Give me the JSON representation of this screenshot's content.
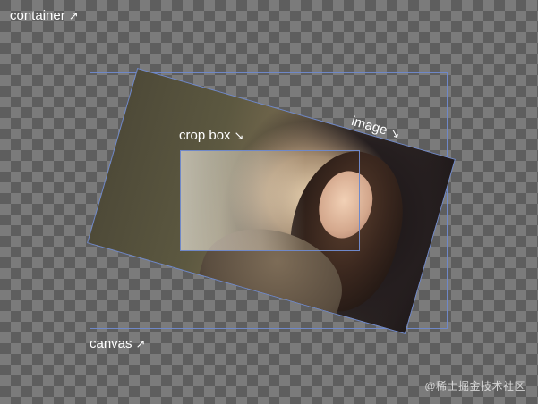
{
  "labels": {
    "container": "container",
    "canvas": "canvas",
    "crop_box": "crop box",
    "image": "image"
  },
  "icons": {
    "container_arrow": "north-east-arrow-icon",
    "canvas_arrow": "north-east-arrow-icon",
    "crop_box_arrow": "south-east-arrow-icon",
    "image_arrow": "south-east-arrow-icon"
  },
  "watermark": "@稀土掘金技术社区",
  "colors": {
    "outline": "#6f88c8",
    "label_text": "#ffffff"
  }
}
